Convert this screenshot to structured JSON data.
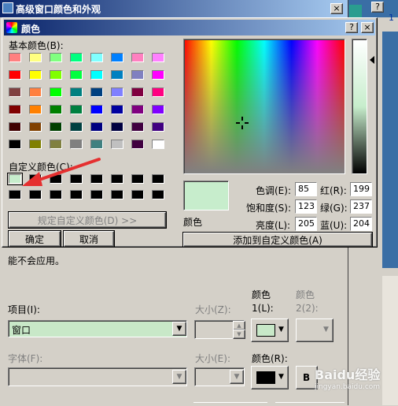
{
  "outer_window": {
    "title": "高级窗口颜色和外观",
    "close_label": "×",
    "help_label": "?",
    "partial_text": "能不会应用。",
    "item_label": "项目(I):",
    "item_value": "窗口",
    "size1_label": "大小(Z):",
    "color1_label": "颜色\n1(L):",
    "color2_label": "颜色\n2(2):",
    "font_label": "字体(F):",
    "size2_label": "大小(E):",
    "font_color_label": "颜色(R):",
    "bold_label": "B",
    "item_color_hex": "#c8e8c8",
    "font_color_hex": "#000000"
  },
  "background_window": {
    "help_label": "?",
    "close_label": "×",
    "number": "1"
  },
  "color_dialog": {
    "title": "颜色",
    "help_label": "?",
    "close_label": "×",
    "basic_label": "基本颜色(B):",
    "custom_label": "自定义颜色(C):",
    "define_button": "规定自定义颜色(D) >>",
    "ok_button": "确定",
    "cancel_button": "取消",
    "preview_label": "颜色",
    "hue_label": "色调(E):",
    "sat_label": "饱和度(S):",
    "lum_label": "亮度(L):",
    "red_label": "红(R):",
    "green_label": "绿(G):",
    "blue_label": "蓝(U):",
    "hue": "85",
    "sat": "123",
    "lum": "205",
    "red": "199",
    "green": "237",
    "blue": "204",
    "add_button": "添加到自定义颜色(A)",
    "preview_color": "#c7edcc",
    "basic_colors": [
      [
        "#ff8080",
        "#ffff80",
        "#80ff80",
        "#00ff80",
        "#80ffff",
        "#0080ff",
        "#ff80c0",
        "#ff80ff"
      ],
      [
        "#ff0000",
        "#ffff00",
        "#80ff00",
        "#00ff40",
        "#00ffff",
        "#0080c0",
        "#8080c0",
        "#ff00ff"
      ],
      [
        "#804040",
        "#ff8040",
        "#00ff00",
        "#008080",
        "#004080",
        "#8080ff",
        "#800040",
        "#ff0080"
      ],
      [
        "#800000",
        "#ff8000",
        "#008000",
        "#008040",
        "#0000ff",
        "#0000a0",
        "#800080",
        "#8000ff"
      ],
      [
        "#400000",
        "#804000",
        "#004000",
        "#004040",
        "#000080",
        "#000040",
        "#400040",
        "#400080"
      ],
      [
        "#000000",
        "#808000",
        "#808040",
        "#808080",
        "#408080",
        "#c0c0c0",
        "#400040",
        "#ffffff"
      ]
    ],
    "custom_colors": [
      [
        "#c7edcc",
        "#000000",
        "#000000",
        "#000000",
        "#000000",
        "#000000",
        "#000000",
        "#000000"
      ],
      [
        "#000000",
        "#000000",
        "#000000",
        "#000000",
        "#000000",
        "#000000",
        "#000000",
        "#000000"
      ]
    ]
  },
  "watermark": {
    "text": "Baidu经验",
    "sub": "jingyan.baidu.com"
  }
}
